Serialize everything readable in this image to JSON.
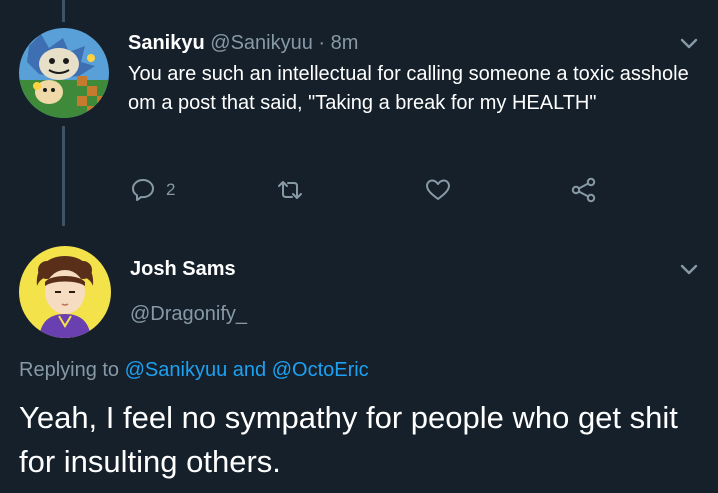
{
  "tweet1": {
    "display_name": "Sanikyu",
    "handle": "@Sanikyuu",
    "separator": "·",
    "time": "8m",
    "text": "You are such an intellectual for calling someone a toxic asshole om a post that said, \"Taking a break for my HEALTH\"",
    "reply_count": "2",
    "avatar_icon": "sonic-monster-avatar"
  },
  "tweet2": {
    "display_name": "Josh Sams",
    "handle": "@Dragonify_",
    "replying_prefix": "Replying to",
    "replying_user1": "@Sanikyuu",
    "replying_and": "and",
    "replying_user2": "@OctoEric",
    "text": "Yeah, I feel no sympathy for people who get shit for insulting others.",
    "avatar_icon": "anime-character-avatar"
  },
  "colors": {
    "background": "#15202b",
    "secondary_text": "#8899a6",
    "link": "#1da1f2",
    "thread_line": "#3d5466"
  }
}
